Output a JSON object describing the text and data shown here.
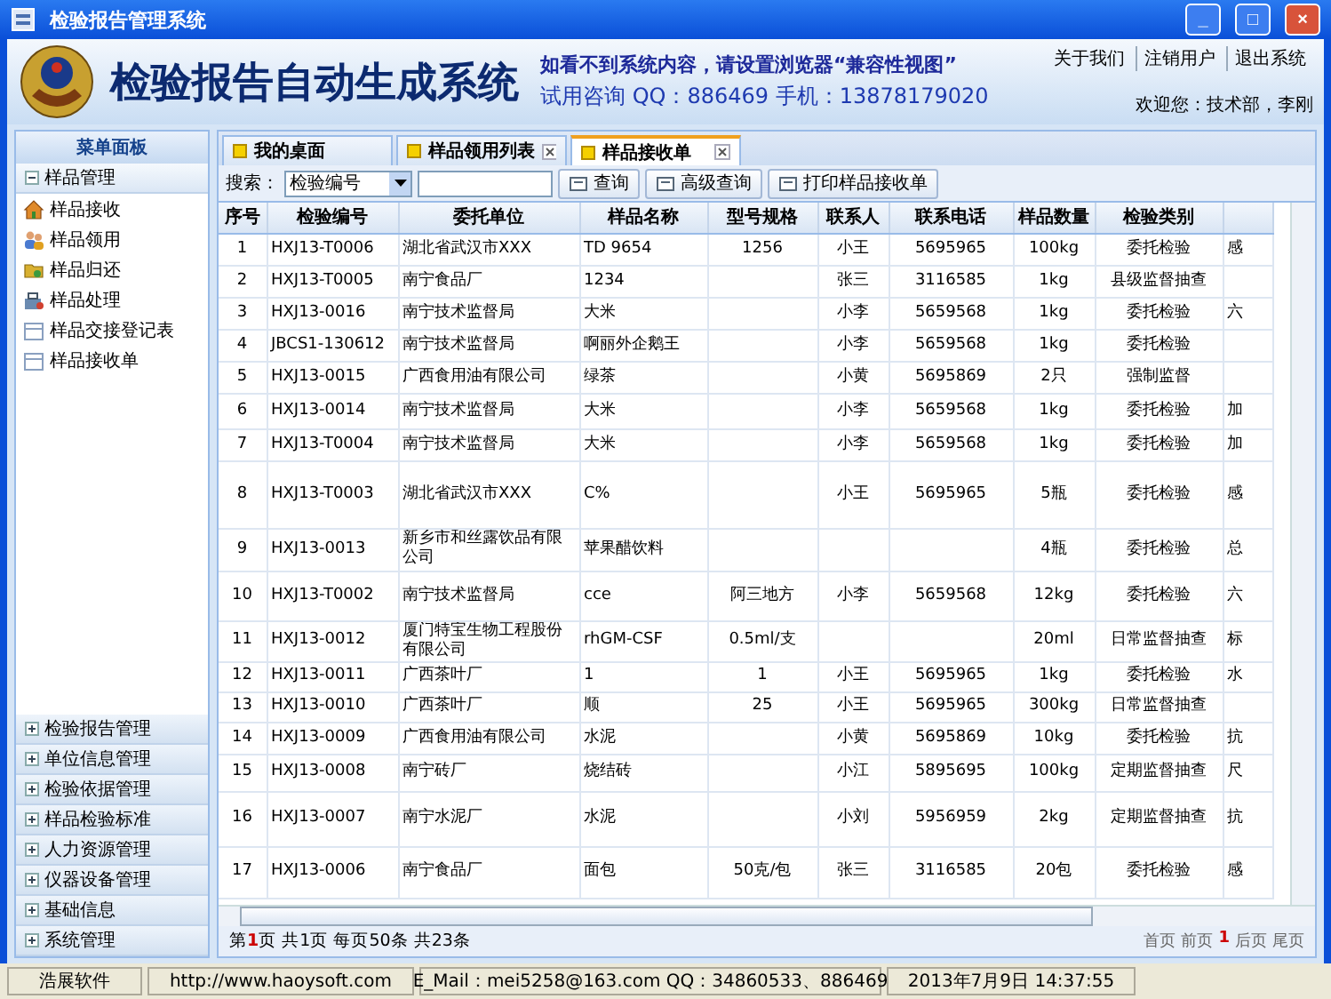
{
  "window": {
    "title": "检验报告管理系统",
    "controls": [
      "_",
      "□",
      "×"
    ]
  },
  "header": {
    "app_title": "检验报告自动生成系统",
    "notice": "如看不到系统内容，请设置浏览器“兼容性视图”",
    "contact": "试用咨询 QQ：886469 手机：13878179020",
    "links": [
      "关于我们",
      "注销用户",
      "退出系统"
    ],
    "welcome": "欢迎您：技术部，李刚"
  },
  "sidebar": {
    "title": "菜单面板",
    "groups_top": [
      {
        "label": "样品管理",
        "expanded": true,
        "children": [
          {
            "label": "样品接收",
            "kind": "house"
          },
          {
            "label": "样品领用",
            "kind": "people"
          },
          {
            "label": "样品归还",
            "kind": "folder"
          },
          {
            "label": "样品处理",
            "kind": "tool"
          },
          {
            "label": "样品交接登记表",
            "kind": "sheet"
          },
          {
            "label": "样品接收单",
            "kind": "sheet"
          }
        ]
      }
    ],
    "groups_bottom": [
      {
        "label": "检验报告管理",
        "expanded": false
      },
      {
        "label": "单位信息管理",
        "expanded": false
      },
      {
        "label": "检验依据管理",
        "expanded": false
      },
      {
        "label": "样品检验标准",
        "expanded": false
      },
      {
        "label": "人力资源管理",
        "expanded": false
      },
      {
        "label": "仪器设备管理",
        "expanded": false
      },
      {
        "label": "基础信息",
        "expanded": false
      },
      {
        "label": "系统管理",
        "expanded": false
      }
    ]
  },
  "tabs": [
    {
      "label": "我的桌面",
      "selected": false,
      "closable": false
    },
    {
      "label": "样品领用列表",
      "selected": false,
      "closable": true
    },
    {
      "label": "样品接收单",
      "selected": true,
      "closable": true
    }
  ],
  "toolbar": {
    "search_label": "搜索：",
    "field_select": "检验编号",
    "buttons": [
      "查询",
      "高级查询",
      "打印样品接收单"
    ]
  },
  "table": {
    "columns": [
      "序号",
      "检验编号",
      "委托单位",
      "样品名称",
      "型号规格",
      "联系人",
      "联系电话",
      "样品数量",
      "检验类别"
    ],
    "rows": [
      [
        "1",
        "HXJ13-T0006",
        "湖北省武汉市XXX",
        "TD 9654",
        "1256",
        "小王",
        "5695965",
        "100kg",
        "委托检验",
        "感"
      ],
      [
        "2",
        "HXJ13-T0005",
        "南宁食品厂",
        "1234",
        "",
        "张三",
        "3116585",
        "1kg",
        "县级监督抽查",
        ""
      ],
      [
        "3",
        "HXJ13-0016",
        "南宁技术监督局",
        "大米",
        "",
        "小李",
        "5659568",
        "1kg",
        "委托检验",
        "六"
      ],
      [
        "4",
        "JBCS1-130612",
        "南宁技术监督局",
        "啊丽外企鹅王",
        "",
        "小李",
        "5659568",
        "1kg",
        "委托检验",
        ""
      ],
      [
        "5",
        "HXJ13-0015",
        "广西食用油有限公司",
        "绿茶",
        "",
        "小黄",
        "5695869",
        "2只",
        "强制监督",
        ""
      ],
      [
        "6",
        "HXJ13-0014",
        "南宁技术监督局",
        "大米",
        "",
        "小李",
        "5659568",
        "1kg",
        "委托检验",
        "加"
      ],
      [
        "7",
        "HXJ13-T0004",
        "南宁技术监督局",
        "大米",
        "",
        "小李",
        "5659568",
        "1kg",
        "委托检验",
        "加"
      ],
      [
        "8",
        "HXJ13-T0003",
        "湖北省武汉市XXX",
        "C%",
        "",
        "小王",
        "5695965",
        "5瓶",
        "委托检验",
        "感"
      ],
      [
        "9",
        "HXJ13-0013",
        "新乡市和丝露饮品有限公司",
        "苹果醋饮料",
        "",
        "",
        "",
        "4瓶",
        "委托检验",
        "总"
      ],
      [
        "10",
        "HXJ13-T0002",
        "南宁技术监督局",
        "cce",
        "阿三地方",
        "小李",
        "5659568",
        "12kg",
        "委托检验",
        "六"
      ],
      [
        "11",
        "HXJ13-0012",
        "厦门特宝生物工程股份有限公司",
        "rhGM-CSF",
        "0.5ml/支",
        "",
        "",
        "20ml",
        "日常监督抽查",
        "标"
      ],
      [
        "12",
        "HXJ13-0011",
        "广西茶叶厂",
        "1",
        "1",
        "小王",
        "5695965",
        "1kg",
        "委托检验",
        "水"
      ],
      [
        "13",
        "HXJ13-0010",
        "广西茶叶厂",
        "顺",
        "25",
        "小王",
        "5695965",
        "300kg",
        "日常监督抽查",
        ""
      ],
      [
        "14",
        "HXJ13-0009",
        "广西食用油有限公司",
        "水泥",
        "",
        "小黄",
        "5695869",
        "10kg",
        "委托检验",
        "抗"
      ],
      [
        "15",
        "HXJ13-0008",
        "南宁砖厂",
        "烧结砖",
        "",
        "小江",
        "5895695",
        "100kg",
        "定期监督抽查",
        "尺"
      ],
      [
        "16",
        "HXJ13-0007",
        "南宁水泥厂",
        "水泥",
        "",
        "小刘",
        "5956959",
        "2kg",
        "定期监督抽查",
        "抗"
      ],
      [
        "17",
        "HXJ13-0006",
        "南宁食品厂",
        "面包",
        "50克/包",
        "张三",
        "3116585",
        "20包",
        "委托检验",
        "感"
      ]
    ]
  },
  "pager": {
    "info_parts": [
      "第",
      "1",
      "页 共1页 每页50条 共23条"
    ],
    "nav": [
      "首页",
      "前页",
      "1",
      "后页",
      "尾页"
    ]
  },
  "status_bar": [
    "浩展软件",
    "http://www.haoysoft.com",
    "E_Mail：mei5258@163.com  QQ：34860533、886469",
    "2013年7月9日 14:37:55"
  ]
}
